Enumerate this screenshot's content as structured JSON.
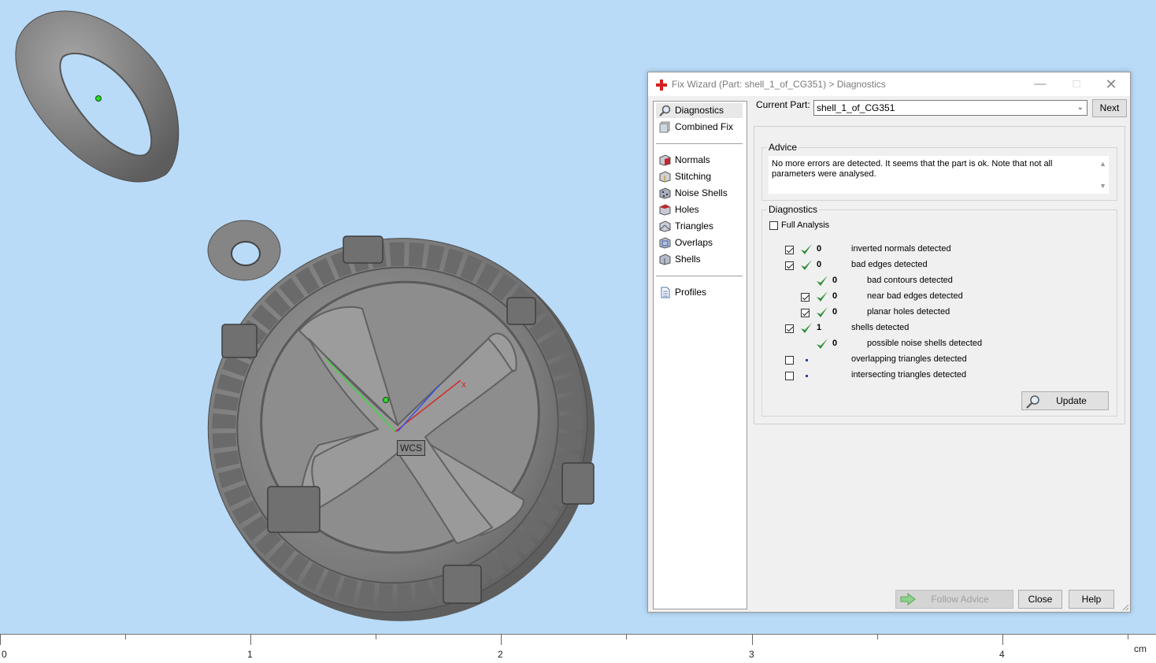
{
  "viewport": {
    "wcs_label": "WCS",
    "axis_x_label": "x"
  },
  "ruler": {
    "labels": [
      "0",
      "1",
      "2",
      "3",
      "4"
    ],
    "unit": "cm"
  },
  "dialog": {
    "title": "Fix Wizard (Part: shell_1_of_CG351) > Diagnostics",
    "nav": {
      "top": [
        {
          "label": "Diagnostics",
          "icon": "magnifier-icon"
        },
        {
          "label": "Combined Fix",
          "icon": "combined-fix-icon"
        }
      ],
      "tools": [
        {
          "label": "Normals",
          "icon": "normals-cube-icon"
        },
        {
          "label": "Stitching",
          "icon": "stitching-cube-icon"
        },
        {
          "label": "Noise Shells",
          "icon": "noise-shells-icon"
        },
        {
          "label": "Holes",
          "icon": "holes-cube-icon"
        },
        {
          "label": "Triangles",
          "icon": "triangles-cube-icon"
        },
        {
          "label": "Overlaps",
          "icon": "overlaps-cube-icon"
        },
        {
          "label": "Shells",
          "icon": "shells-cube-icon"
        }
      ],
      "bottom": [
        {
          "label": "Profiles",
          "icon": "document-icon"
        }
      ]
    },
    "current_part_label": "Current Part:",
    "current_part_value": "shell_1_of_CG351",
    "next_label": "Next",
    "advice": {
      "title": "Advice",
      "text": "No more errors are detected. It seems that the part is ok. Note that not all parameters were analysed."
    },
    "diagnostics": {
      "title": "Diagnostics",
      "full_analysis_label": "Full Analysis",
      "full_analysis_checked": false,
      "rows": [
        {
          "checkbox": true,
          "checked": true,
          "status": "ok",
          "count": "0",
          "label": "inverted normals detected",
          "indent": 0
        },
        {
          "checkbox": true,
          "checked": true,
          "status": "ok",
          "count": "0",
          "label": "bad edges detected",
          "indent": 0
        },
        {
          "checkbox": false,
          "checked": false,
          "status": "ok",
          "count": "0",
          "label": "bad contours detected",
          "indent": 1
        },
        {
          "checkbox": true,
          "checked": true,
          "status": "ok",
          "count": "0",
          "label": "near bad edges detected",
          "indent": 1
        },
        {
          "checkbox": true,
          "checked": true,
          "status": "ok",
          "count": "0",
          "label": "planar holes detected",
          "indent": 1
        },
        {
          "checkbox": true,
          "checked": true,
          "status": "ok",
          "count": "1",
          "label": "shells detected",
          "indent": 0
        },
        {
          "checkbox": false,
          "checked": false,
          "status": "ok",
          "count": "0",
          "label": "possible noise shells detected",
          "indent": 1
        },
        {
          "checkbox": true,
          "checked": false,
          "status": "unknown",
          "count": "",
          "label": "overlapping triangles detected",
          "indent": 0
        },
        {
          "checkbox": true,
          "checked": false,
          "status": "unknown",
          "count": "",
          "label": "intersecting triangles detected",
          "indent": 0
        }
      ],
      "update_label": "Update"
    },
    "follow_advice_label": "Follow Advice",
    "close_label": "Close",
    "help_label": "Help"
  },
  "colors": {
    "viewport_bg": "#b9dbf7",
    "check_green": "#2e8b3a",
    "app_icon_red": "#d41f1f"
  }
}
